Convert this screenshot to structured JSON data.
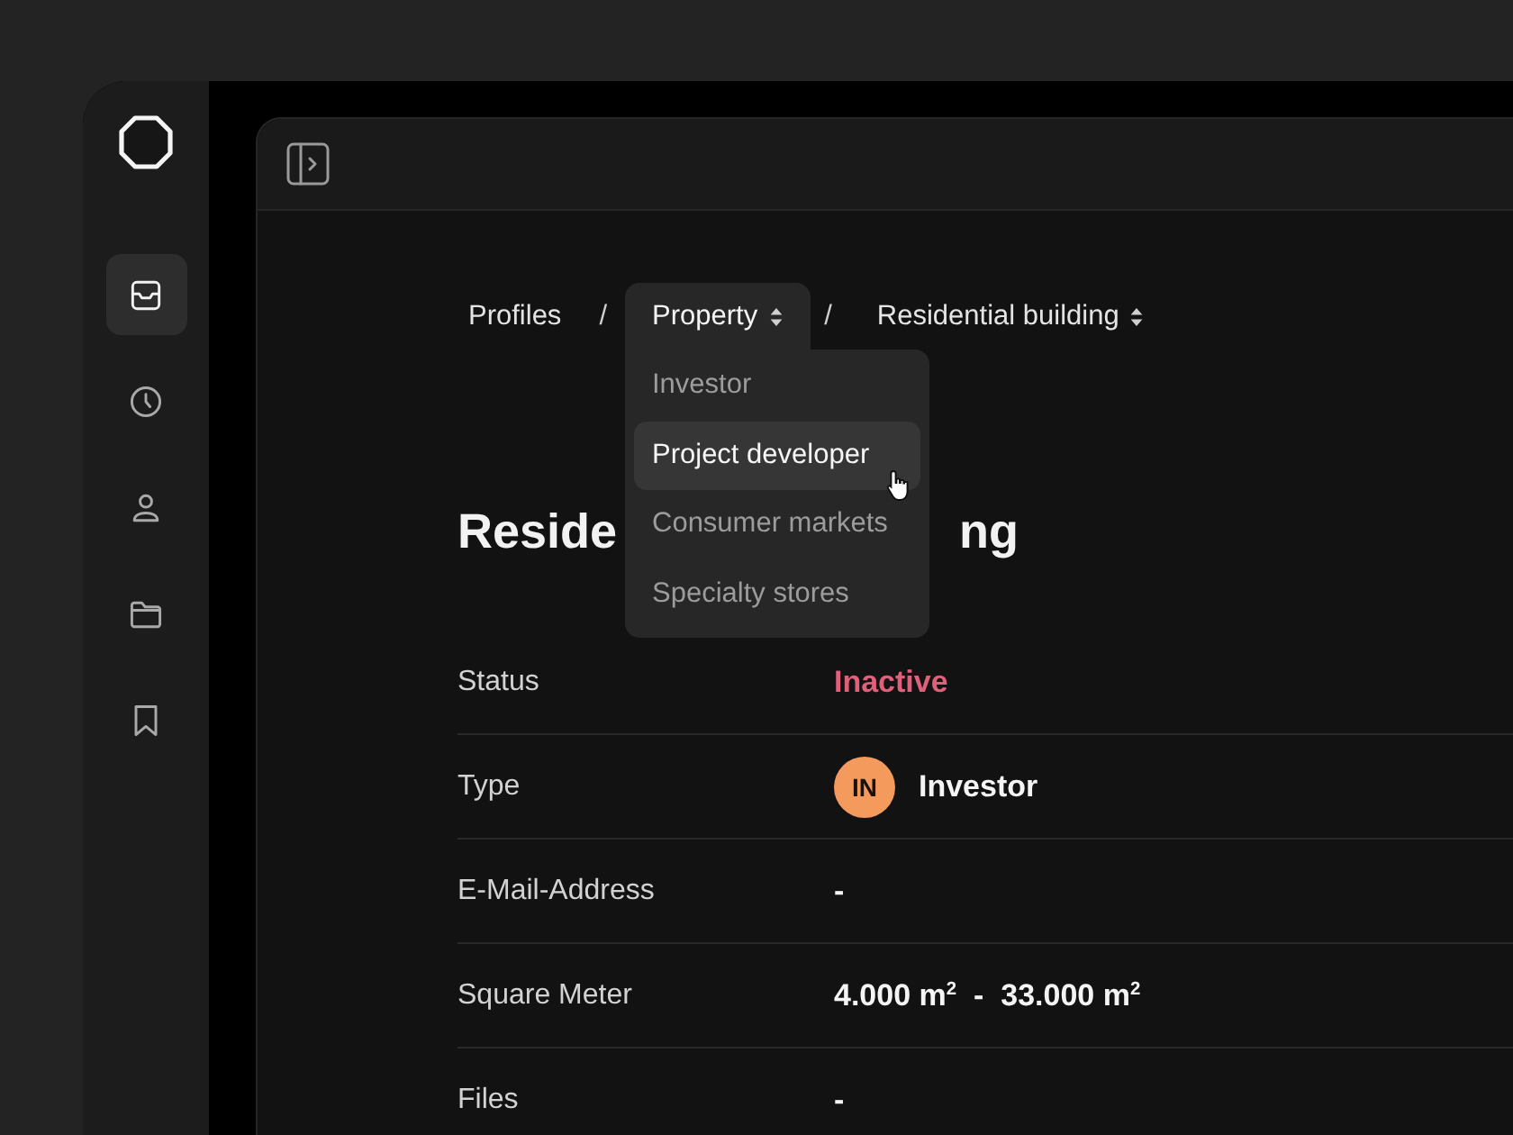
{
  "sidebar": {
    "items": [
      {
        "selected": true
      },
      {
        "selected": false
      },
      {
        "selected": false
      },
      {
        "selected": false
      },
      {
        "selected": false
      }
    ]
  },
  "breadcrumb": [
    {
      "label": "Profiles",
      "kind": "link",
      "open": false
    },
    {
      "label": "Property",
      "kind": "dropdown",
      "open": true
    },
    {
      "label": "Residential building",
      "kind": "dropdown",
      "open": false
    }
  ],
  "separator": "/",
  "dropdown_menu": [
    {
      "label": "Investor",
      "selected": false
    },
    {
      "label": "Project developer",
      "selected": true
    },
    {
      "label": "Consumer markets",
      "selected": false
    },
    {
      "label": "Specialty stores",
      "selected": false
    }
  ],
  "heading_parts": [
    "Reside",
    "ng"
  ],
  "details": [
    {
      "label": "Status",
      "kind": "status",
      "value": "Inactive"
    },
    {
      "label": "Type",
      "kind": "avatar",
      "initials": "IN",
      "color": "#f39a5c",
      "value": "Investor"
    },
    {
      "label": "E-Mail-Address",
      "kind": "text",
      "value": "-"
    },
    {
      "label": "Square Meter",
      "kind": "text",
      "value": "4.000 m$^{2}$  -  33.000 m$^{2}$"
    },
    {
      "label": "Files",
      "kind": "text",
      "value": "-"
    }
  ]
}
